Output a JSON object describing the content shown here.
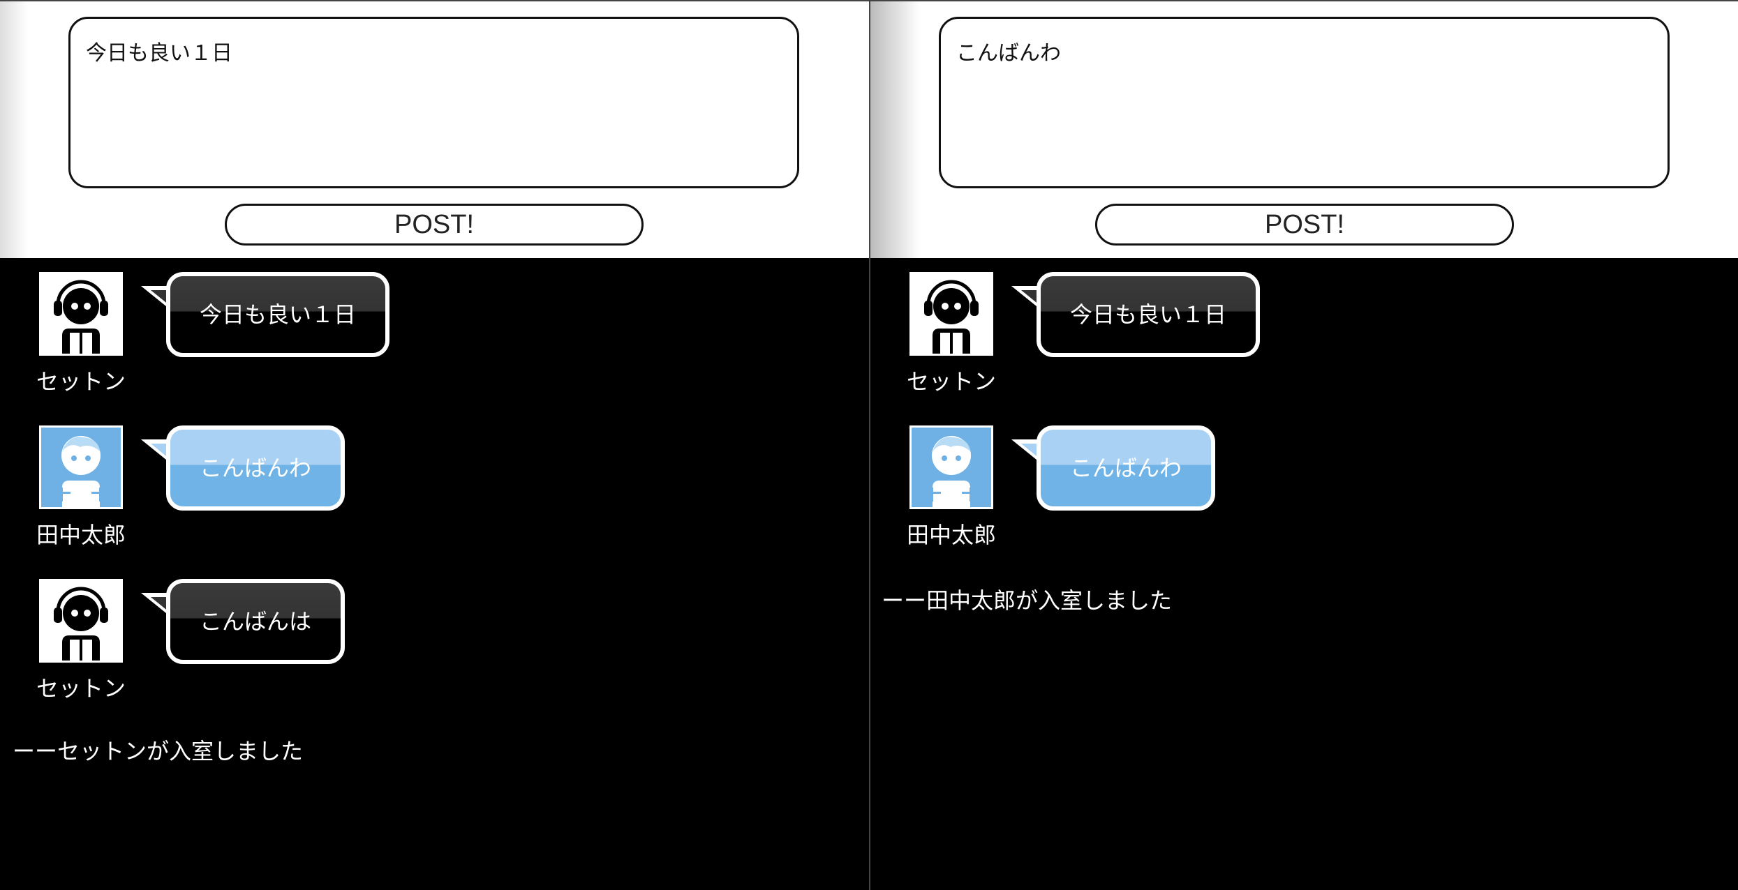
{
  "left_pane": {
    "input_value": "今日も良い１日",
    "post_label": "POST!",
    "messages": [
      {
        "user": "セットン",
        "text": "今日も良い１日",
        "style": "dark",
        "avatar": "headphones-user-icon"
      },
      {
        "user": "田中太郎",
        "text": "こんばんわ",
        "style": "blue",
        "avatar": "blue-user-icon"
      },
      {
        "user": "セットン",
        "text": "こんばんは",
        "style": "dark",
        "avatar": "headphones-user-icon"
      }
    ],
    "notice": "ーーセットンが入室しました"
  },
  "right_pane": {
    "input_value": "こんばんわ",
    "post_label": "POST!",
    "messages": [
      {
        "user": "セットン",
        "text": "今日も良い１日",
        "style": "dark",
        "avatar": "headphones-user-icon"
      },
      {
        "user": "田中太郎",
        "text": "こんばんわ",
        "style": "blue",
        "avatar": "blue-user-icon"
      }
    ],
    "notice": "ーー田中太郎が入室しました"
  },
  "colors": {
    "background": "#000000",
    "header": "#ffffff",
    "bubble_dark": "#000000",
    "bubble_blue": "#70b3e6",
    "bubble_blue_light": "#a9d1f3"
  }
}
